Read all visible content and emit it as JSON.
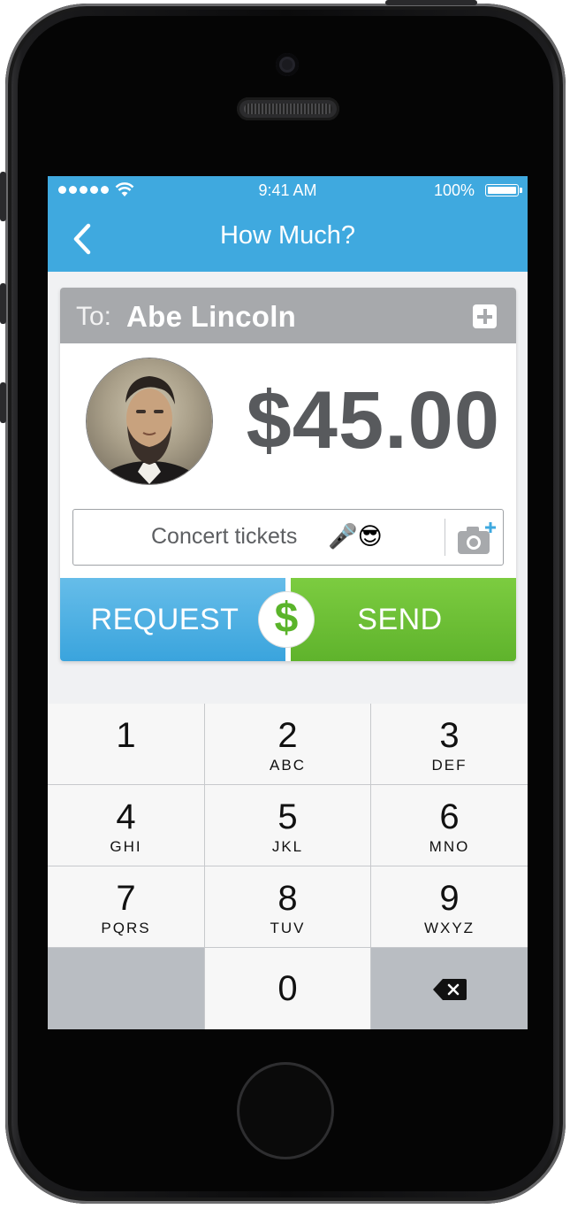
{
  "status_bar": {
    "time": "9:41 AM",
    "battery": "100%"
  },
  "nav": {
    "title": "How Much?"
  },
  "recipient": {
    "to_label": "To:",
    "name": "Abe Lincoln"
  },
  "payment": {
    "amount": "$45.00"
  },
  "note": {
    "text": "Concert tickets",
    "emoji": "🎤😎"
  },
  "actions": {
    "request_label": "REQUEST",
    "send_label": "SEND",
    "badge_symbol": "$"
  },
  "keypad": {
    "keys": [
      {
        "digit": "1",
        "letters": ""
      },
      {
        "digit": "2",
        "letters": "ABC"
      },
      {
        "digit": "3",
        "letters": "DEF"
      },
      {
        "digit": "4",
        "letters": "GHI"
      },
      {
        "digit": "5",
        "letters": "JKL"
      },
      {
        "digit": "6",
        "letters": "MNO"
      },
      {
        "digit": "7",
        "letters": "PQRS"
      },
      {
        "digit": "8",
        "letters": "TUV"
      },
      {
        "digit": "9",
        "letters": "WXYZ"
      },
      {
        "digit": "0",
        "letters": ""
      }
    ]
  },
  "colors": {
    "nav_blue": "#3fa9df",
    "send_green": "#6cbf35",
    "amount_gray": "#585a5d",
    "to_bar_gray": "#a7a9ac"
  },
  "icons": {
    "back": "chevron-left-icon",
    "add_contact": "plus-square-icon",
    "camera": "camera-plus-icon",
    "delete": "backspace-icon"
  }
}
